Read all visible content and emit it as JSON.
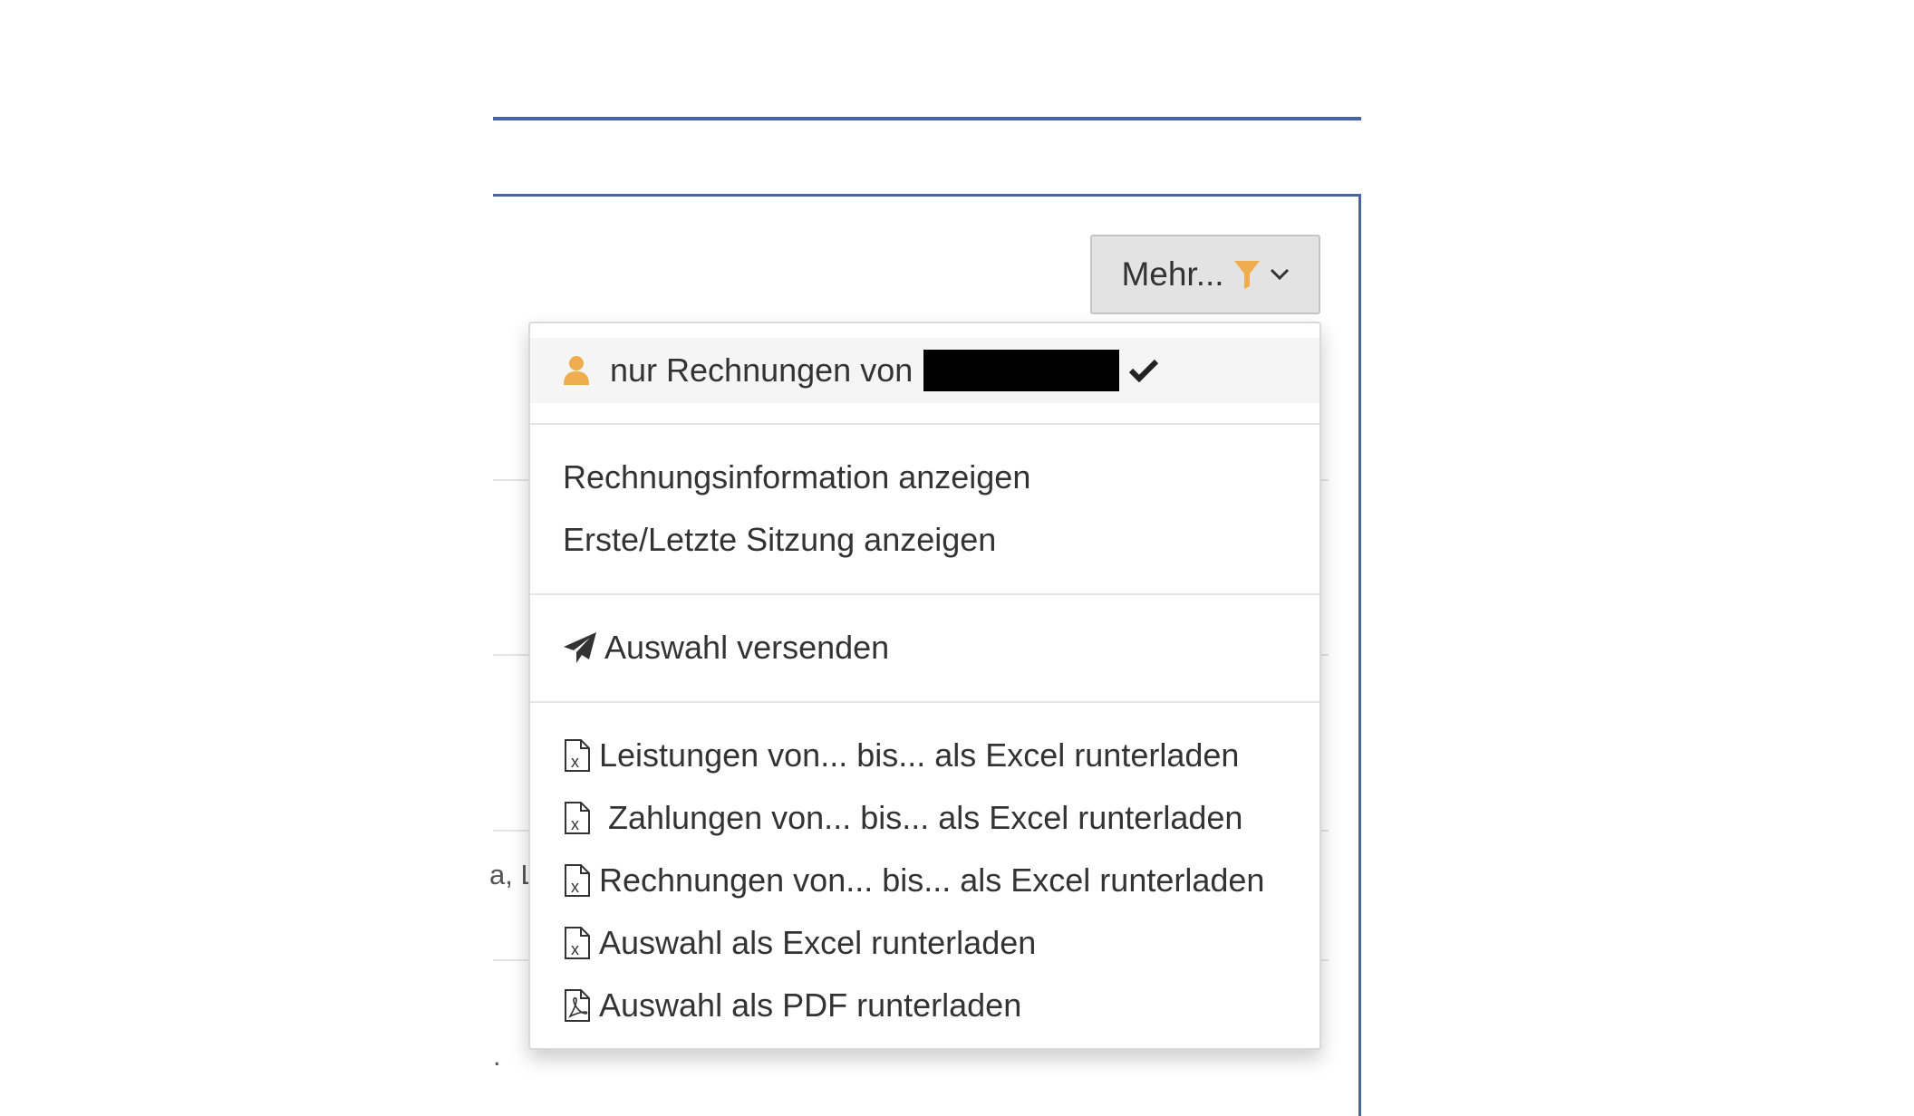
{
  "colors": {
    "accent": "#4a62a8",
    "orange": "#f0ad4e",
    "text": "#333333"
  },
  "background": {
    "partial_text": "a, L",
    "dot": "."
  },
  "toolbar": {
    "mehr_label": "Mehr...",
    "filter_icon": "filter-icon",
    "chevron_icon": "chevron-down-icon"
  },
  "menu": {
    "own_invoices": {
      "label": "nur Rechnungen von",
      "checked": true,
      "icon": "user-icon"
    },
    "invoice_info": "Rechnungsinformation anzeigen",
    "first_last_session": "Erste/Letzte Sitzung anzeigen",
    "send_selection": {
      "label": "Auswahl versenden",
      "icon": "paper-plane-icon"
    },
    "exports": [
      {
        "label": "Leistungen von... bis... als Excel runterladen",
        "icon": "excel-file-icon"
      },
      {
        "label": " Zahlungen von... bis... als Excel runterladen",
        "icon": "excel-file-icon"
      },
      {
        "label": "Rechnungen von... bis... als Excel runterladen",
        "icon": "excel-file-icon"
      },
      {
        "label": "Auswahl als Excel runterladen",
        "icon": "excel-file-icon"
      },
      {
        "label": "Auswahl als PDF runterladen",
        "icon": "pdf-file-icon"
      }
    ]
  }
}
